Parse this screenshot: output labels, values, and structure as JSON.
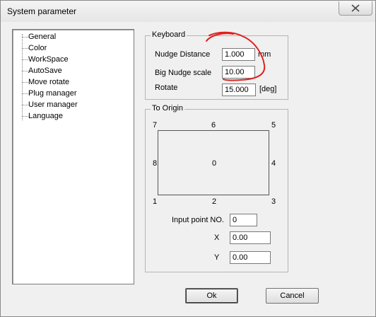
{
  "window": {
    "title": "System parameter"
  },
  "tree": {
    "items": [
      {
        "label": "General"
      },
      {
        "label": "Color"
      },
      {
        "label": "WorkSpace"
      },
      {
        "label": "AutoSave"
      },
      {
        "label": "Move rotate"
      },
      {
        "label": "Plug manager"
      },
      {
        "label": "User manager"
      },
      {
        "label": "Language"
      }
    ]
  },
  "keyboard": {
    "title": "Keyboard",
    "nudge_label": "Nudge Distance",
    "nudge_value": "1.000",
    "nudge_unit": "mm",
    "big_nudge_label": "Big Nudge scale",
    "big_nudge_value": "10.00",
    "rotate_label": "Rotate",
    "rotate_value": "15.000",
    "rotate_unit": "[deg]"
  },
  "origin": {
    "title": "To Origin",
    "points": [
      "7",
      "6",
      "5",
      "8",
      "0",
      "4",
      "1",
      "2",
      "3"
    ],
    "input_point_label": "Input point NO.",
    "input_point_value": "0",
    "x_label": "X",
    "x_value": "0.00",
    "y_label": "Y",
    "y_value": "0.00"
  },
  "buttons": {
    "ok": "Ok",
    "cancel": "Cancel"
  },
  "annotation_color": "#e02020",
  "icons": {
    "close": "close-icon"
  }
}
